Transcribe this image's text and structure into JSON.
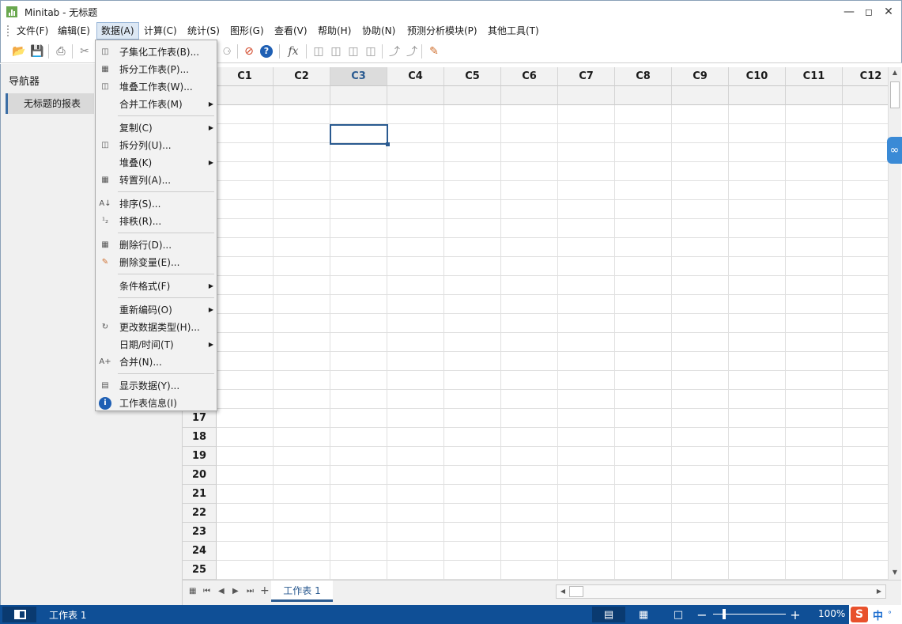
{
  "window": {
    "title": "Minitab - 无标题"
  },
  "menubar": [
    "文件(F)",
    "编辑(E)",
    "数据(A)",
    "计算(C)",
    "统计(S)",
    "图形(G)",
    "查看(V)",
    "帮助(H)",
    "协助(N)",
    "预测分析模块(P)",
    "其他工具(T)"
  ],
  "dropdown": {
    "items": [
      {
        "label": "子集化工作表(B)...",
        "icon": "subset-worksheet-icon"
      },
      {
        "label": "拆分工作表(P)...",
        "icon": "split-worksheet-icon"
      },
      {
        "label": "堆叠工作表(W)...",
        "icon": "stack-worksheets-icon"
      },
      {
        "label": "合并工作表(M)",
        "submenu": true
      },
      {
        "label": "复制(C)",
        "submenu": true
      },
      {
        "label": "拆分列(U)...",
        "icon": "split-columns-icon"
      },
      {
        "label": "堆叠(K)",
        "submenu": true
      },
      {
        "label": "转置列(A)...",
        "icon": "transpose-columns-icon"
      },
      {
        "label": "排序(S)...",
        "icon": "sort-icon"
      },
      {
        "label": "排秩(R)...",
        "icon": "rank-icon"
      },
      {
        "label": "删除行(D)...",
        "icon": "delete-rows-icon"
      },
      {
        "label": "删除变量(E)...",
        "icon": "eraser-icon"
      },
      {
        "label": "条件格式(F)",
        "submenu": true
      },
      {
        "label": "重新编码(O)",
        "submenu": true
      },
      {
        "label": "更改数据类型(H)...",
        "icon": "change-data-type-icon"
      },
      {
        "label": "日期/时间(T)",
        "submenu": true
      },
      {
        "label": "合并(N)...",
        "icon": "combine-icon"
      },
      {
        "label": "显示数据(Y)...",
        "icon": "display-data-icon"
      },
      {
        "label": "工作表信息(I)",
        "icon": "info-icon"
      }
    ]
  },
  "navigator": {
    "header": "导航器",
    "items": [
      "无标题的报表"
    ]
  },
  "grid": {
    "columns": [
      "C1",
      "C2",
      "C3",
      "C4",
      "C5",
      "C6",
      "C7",
      "C8",
      "C9",
      "C10",
      "C11",
      "C12"
    ],
    "selected_column": "C3",
    "visible_rows": [
      "17",
      "18",
      "19",
      "20",
      "21",
      "22",
      "23",
      "24",
      "25"
    ]
  },
  "sheet_tab": "工作表 1",
  "statusbar": {
    "sheet": "工作表 1",
    "zoom": "100%"
  },
  "ime": {
    "lang": "中"
  }
}
